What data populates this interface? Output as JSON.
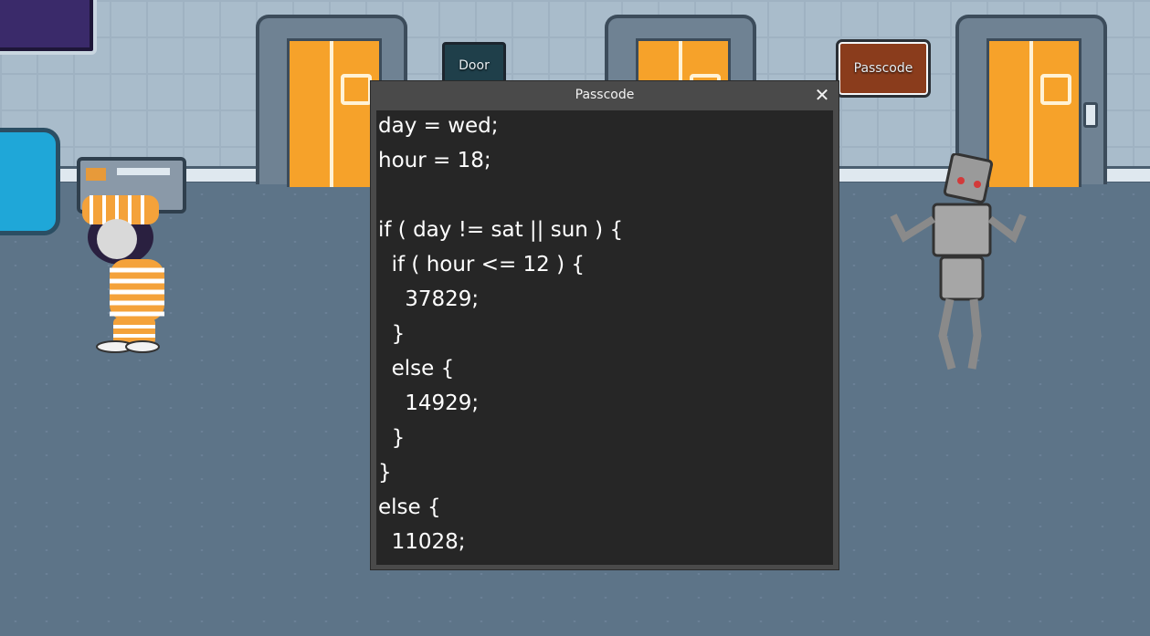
{
  "scene": {
    "door_sign_label": "Door",
    "passcode_sign_label": "Passcode"
  },
  "dialog": {
    "title": "Passcode",
    "close_icon": "close-icon",
    "code_lines": [
      "day = wed;",
      "hour = 18;",
      "",
      "if ( day != sat || sun ) {",
      "  if ( hour <= 12 ) {",
      "    37829;",
      "  }",
      "  else {",
      "    14929;",
      "  }",
      "}",
      "else {",
      "  11028;"
    ]
  },
  "colors": {
    "door_orange": "#f6a22a",
    "wall": "#a9bccb",
    "floor": "#5d7488",
    "dialog_frame": "#4a4a4a",
    "dialog_body": "#262626"
  }
}
